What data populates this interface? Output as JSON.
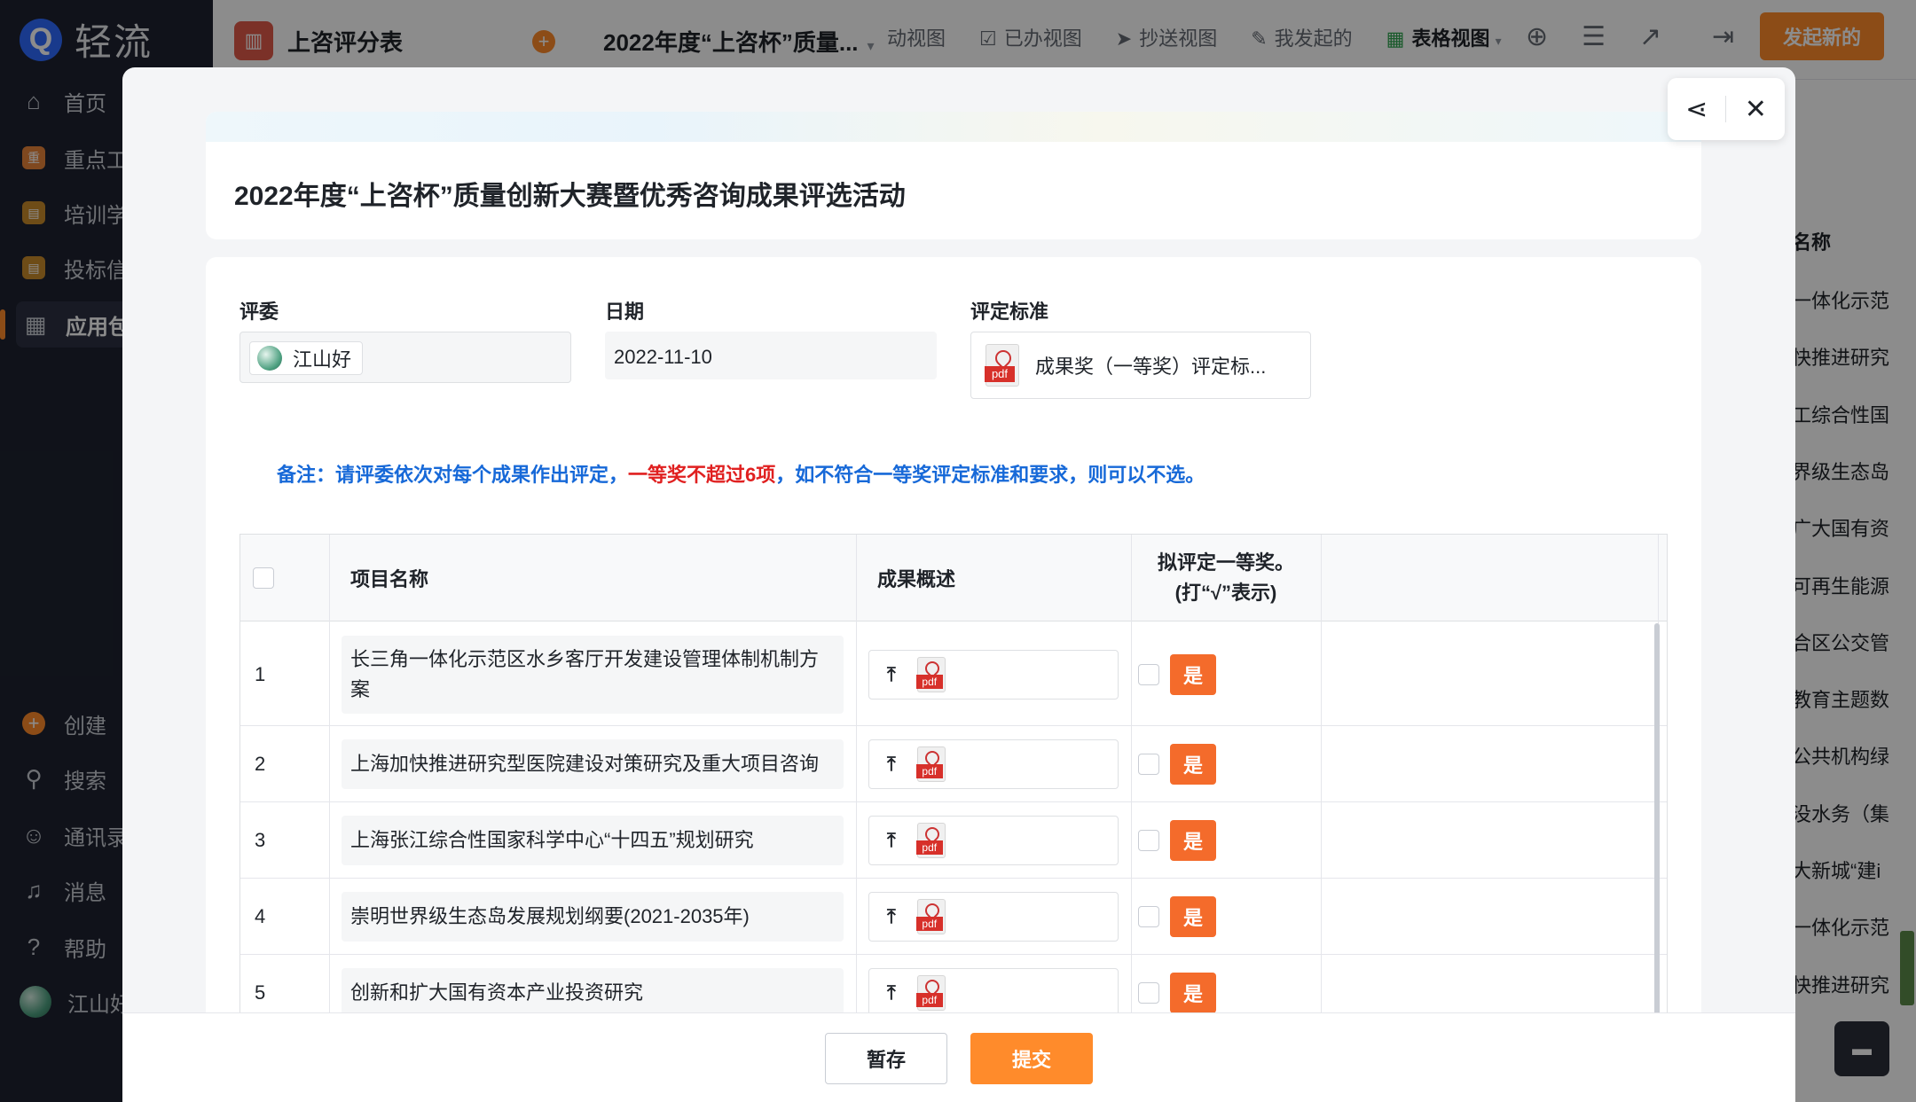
{
  "sidebar": {
    "logo_text": "轻流",
    "logo_letter": "Q",
    "items": [
      {
        "label": "首页",
        "icon": "home-icon"
      },
      {
        "label": "重点工",
        "icon": "key-work-icon",
        "glyph": "重"
      },
      {
        "label": "培训学",
        "icon": "training-icon"
      },
      {
        "label": "投标信",
        "icon": "bid-icon"
      },
      {
        "label": "应用包",
        "icon": "apps-icon"
      }
    ],
    "bottom": [
      {
        "label": "创建",
        "icon": "plus-icon"
      },
      {
        "label": "搜索",
        "icon": "search-icon"
      },
      {
        "label": "通讯录",
        "icon": "contacts-icon"
      },
      {
        "label": "消息",
        "icon": "bell-icon"
      },
      {
        "label": "帮助",
        "icon": "help-icon"
      },
      {
        "label": "江山好",
        "icon": "avatar"
      }
    ]
  },
  "topbar": {
    "app_name": "上咨评分表",
    "form_title": "2022年度“上咨杯”质量...",
    "views": [
      "动视图",
      "已办视图",
      "抄送视图",
      "我发起的",
      "表格视图"
    ],
    "start_button": "发起新的"
  },
  "background_table": {
    "header": "名称",
    "rows": [
      "一体化示范",
      "快推进研究",
      "工综合性国",
      "界级生态岛",
      "广大国有资",
      "可再生能源",
      "合区公交管",
      "教育主题数",
      "公共机构绿",
      "没水务（集",
      "大新城“建i",
      "一体化示范",
      "快推进研究"
    ]
  },
  "modal": {
    "title": "2022年度“上咨杯”质量创新大赛暨优秀咨询成果评选活动",
    "fields": {
      "judge_label": "评委",
      "judge_value": "江山好",
      "date_label": "日期",
      "date_value": "2022-11-10",
      "standard_label": "评定标准",
      "standard_file": "成果奖（一等奖）评定标..."
    },
    "note": {
      "part1": "备注：请评委依次对每个成果作出评定，",
      "part2": "一等奖不超过6项",
      "part3": "，如不符合一等奖评定标准和要求，则可以不选。"
    },
    "table": {
      "headers": {
        "name": "项目名称",
        "summary": "成果概述",
        "award_line1": "拟评定一等奖。",
        "award_line2": "(打“√”表示)"
      },
      "rows": [
        {
          "idx": "1",
          "name": "长三角一体化示范区水乡客厅开发建设管理体制机制方案",
          "pdf": "pdf",
          "yes": "是"
        },
        {
          "idx": "2",
          "name": "上海加快推进研究型医院建设对策研究及重大项目咨询",
          "pdf": "pdf",
          "yes": "是"
        },
        {
          "idx": "3",
          "name": "上海张江综合性国家科学中心“十四五”规划研究",
          "pdf": "pdf",
          "yes": "是"
        },
        {
          "idx": "4",
          "name": "崇明世界级生态岛发展规划纲要(2021-2035年)",
          "pdf": "pdf",
          "yes": "是"
        },
        {
          "idx": "5",
          "name": "创新和扩大国有资本产业投资研究",
          "pdf": "pdf",
          "yes": "是"
        }
      ]
    },
    "footer": {
      "save": "暂存",
      "submit": "提交"
    }
  },
  "colors": {
    "accent_orange": "#ff8b2b",
    "note_blue": "#1769d8",
    "note_red": "#e02020",
    "yes_button": "#f46b2b"
  }
}
